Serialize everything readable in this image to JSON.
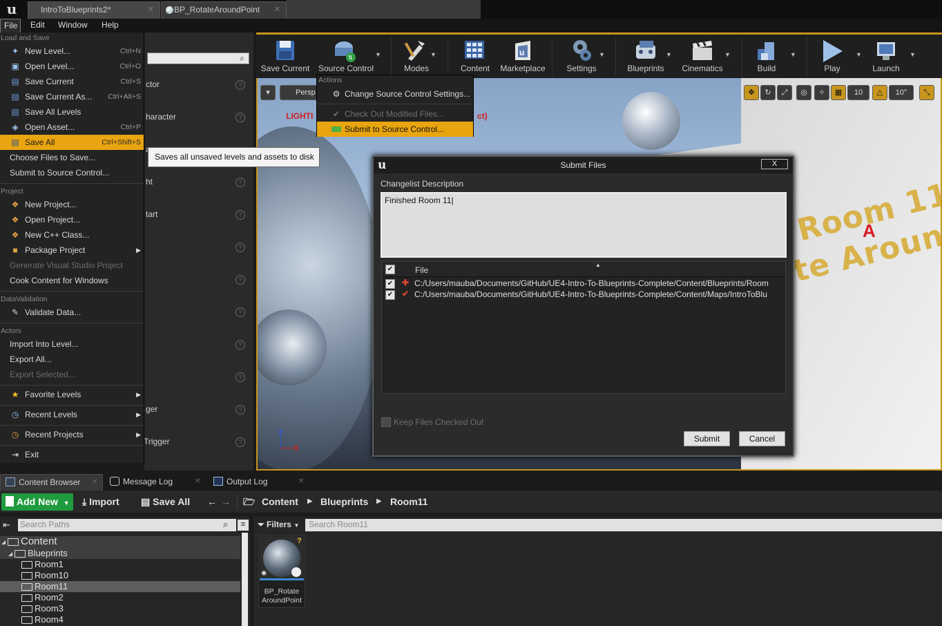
{
  "window": {
    "tabs": [
      {
        "label": "IntroToBlueprints2*"
      },
      {
        "label": "BP_RotateAroundPoint"
      }
    ]
  },
  "menubar": [
    "File",
    "Edit",
    "Window",
    "Help"
  ],
  "file_menu": {
    "sections": {
      "load_save": "Load and Save",
      "project": "Project",
      "data_validation": "DataValidation",
      "actors": "Actors"
    },
    "items": {
      "new_level": {
        "label": "New Level...",
        "shortcut": "Ctrl+N"
      },
      "open_level": {
        "label": "Open Level...",
        "shortcut": "Ctrl+O"
      },
      "save_current": {
        "label": "Save Current",
        "shortcut": "Ctrl+S"
      },
      "save_current_as": {
        "label": "Save Current As...",
        "shortcut": "Ctrl+Alt+S"
      },
      "save_all_levels": {
        "label": "Save All Levels",
        "shortcut": ""
      },
      "open_asset": {
        "label": "Open Asset...",
        "shortcut": "Ctrl+P"
      },
      "save_all": {
        "label": "Save All",
        "shortcut": "Ctrl+Shift+S"
      },
      "choose_files": {
        "label": "Choose Files to Save..."
      },
      "submit_sc": {
        "label": "Submit to Source Control..."
      },
      "new_project": {
        "label": "New Project..."
      },
      "open_project": {
        "label": "Open Project..."
      },
      "new_cpp": {
        "label": "New C++ Class..."
      },
      "package_project": {
        "label": "Package Project"
      },
      "gen_vs": {
        "label": "Generate Visual Studio Project"
      },
      "cook": {
        "label": "Cook Content for Windows"
      },
      "validate": {
        "label": "Validate Data..."
      },
      "import": {
        "label": "Import Into Level..."
      },
      "export_all": {
        "label": "Export All..."
      },
      "export_sel": {
        "label": "Export Selected..."
      },
      "fav_levels": {
        "label": "Favorite Levels"
      },
      "recent_levels": {
        "label": "Recent Levels"
      },
      "recent_projects": {
        "label": "Recent Projects"
      },
      "exit": {
        "label": "Exit"
      }
    }
  },
  "tooltip": "Saves all unsaved levels and assets to disk",
  "details_fragments": [
    "ctor",
    "haracter",
    "a",
    "ht",
    "tart",
    "ger",
    "Trigger"
  ],
  "toolbar": {
    "buttons": [
      "Save Current",
      "Source Control",
      "Modes",
      "Content",
      "Marketplace",
      "Settings",
      "Blueprints",
      "Cinematics",
      "Build",
      "Play",
      "Launch"
    ]
  },
  "viewport": {
    "perspective": "Persp",
    "lighting_warning": "LIGHTI",
    "lighting_warning_tail": "ct)",
    "room_text_line1": "Room 11:",
    "room_text_line2": "te Around",
    "marker": "A",
    "grid_snap": "10",
    "rot_snap": "10°",
    "axis_z": "Z",
    "axis_x": "X"
  },
  "source_control_menu": {
    "header": "Actions",
    "items": [
      "Change Source Control Settings...",
      "Check Out Modified Files...",
      "Submit to Source Control..."
    ]
  },
  "submit_dialog": {
    "title": "Submit Files",
    "close": "X",
    "changelist_label": "Changelist Description",
    "changelist_value": "Finished Room 11|",
    "file_column": "File",
    "files": [
      {
        "path": "C:/Users/mauba/Documents/GitHub/UE4-Intro-To-Blueprints-Complete/Content/Blueprints/Room",
        "status": "added"
      },
      {
        "path": "C:/Users/mauba/Documents/GitHub/UE4-Intro-To-Blueprints-Complete/Content/Maps/IntroToBlu",
        "status": "modified"
      }
    ],
    "keep_checked_out": "Keep Files Checked Out",
    "submit": "Submit",
    "cancel": "Cancel"
  },
  "bottom_tabs": [
    "Content Browser",
    "Message Log",
    "Output Log"
  ],
  "content_browser": {
    "add_new": "Add New",
    "import": "Import",
    "save_all": "Save All",
    "breadcrumbs": [
      "Content",
      "Blueprints",
      "Room11"
    ],
    "search_paths_placeholder": "Search Paths",
    "filters": "Filters",
    "search_assets_placeholder": "Search Room11",
    "tree": [
      {
        "label": "Content"
      },
      {
        "label": "Blueprints"
      },
      {
        "label": "Room1"
      },
      {
        "label": "Room10"
      },
      {
        "label": "Room11"
      },
      {
        "label": "Room2"
      },
      {
        "label": "Room3"
      },
      {
        "label": "Room4"
      }
    ],
    "asset": {
      "name_line1": "BP_Rotate",
      "name_line2": "AroundPoint"
    }
  }
}
